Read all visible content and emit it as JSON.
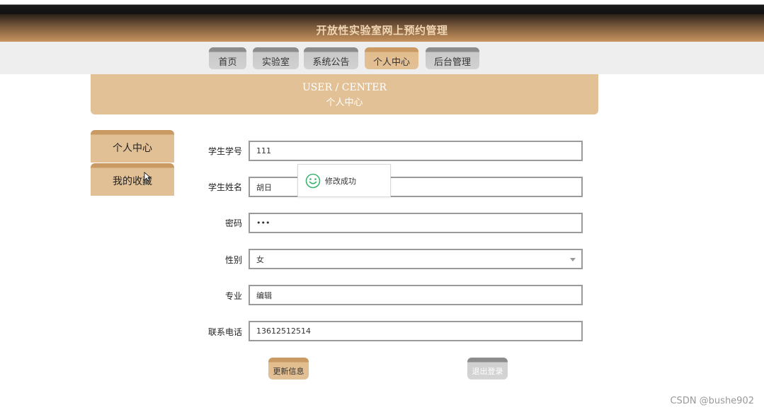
{
  "banner": {
    "title": "开放性实验室网上预约管理"
  },
  "nav": {
    "tabs": [
      {
        "label": "首页"
      },
      {
        "label": "实验室"
      },
      {
        "label": "系统公告"
      },
      {
        "label": "个人中心"
      },
      {
        "label": "后台管理"
      }
    ],
    "active": "个人中心"
  },
  "header": {
    "en": "USER / CENTER",
    "cn": "个人中心"
  },
  "sidebar": {
    "items": [
      {
        "label": "个人中心"
      },
      {
        "label": "我的收藏"
      }
    ]
  },
  "form": {
    "fields": [
      {
        "label": "学生学号",
        "value": "111"
      },
      {
        "label": "学生姓名",
        "value": "胡日"
      },
      {
        "label": "密码",
        "value": "•••"
      },
      {
        "label": "性别",
        "value": "女"
      },
      {
        "label": "专业",
        "value": "编辑"
      },
      {
        "label": "联系电话",
        "value": "13612512514"
      }
    ],
    "update_label": "更新信息",
    "logout_label": "退出登录"
  },
  "toast": {
    "message": "修改成功",
    "icon": "smiley-icon"
  },
  "watermark": "CSDN @bushe902",
  "colors": {
    "accent": "#e2c096",
    "banner_dark": "#2a2018",
    "toast_icon": "#3cb371"
  }
}
